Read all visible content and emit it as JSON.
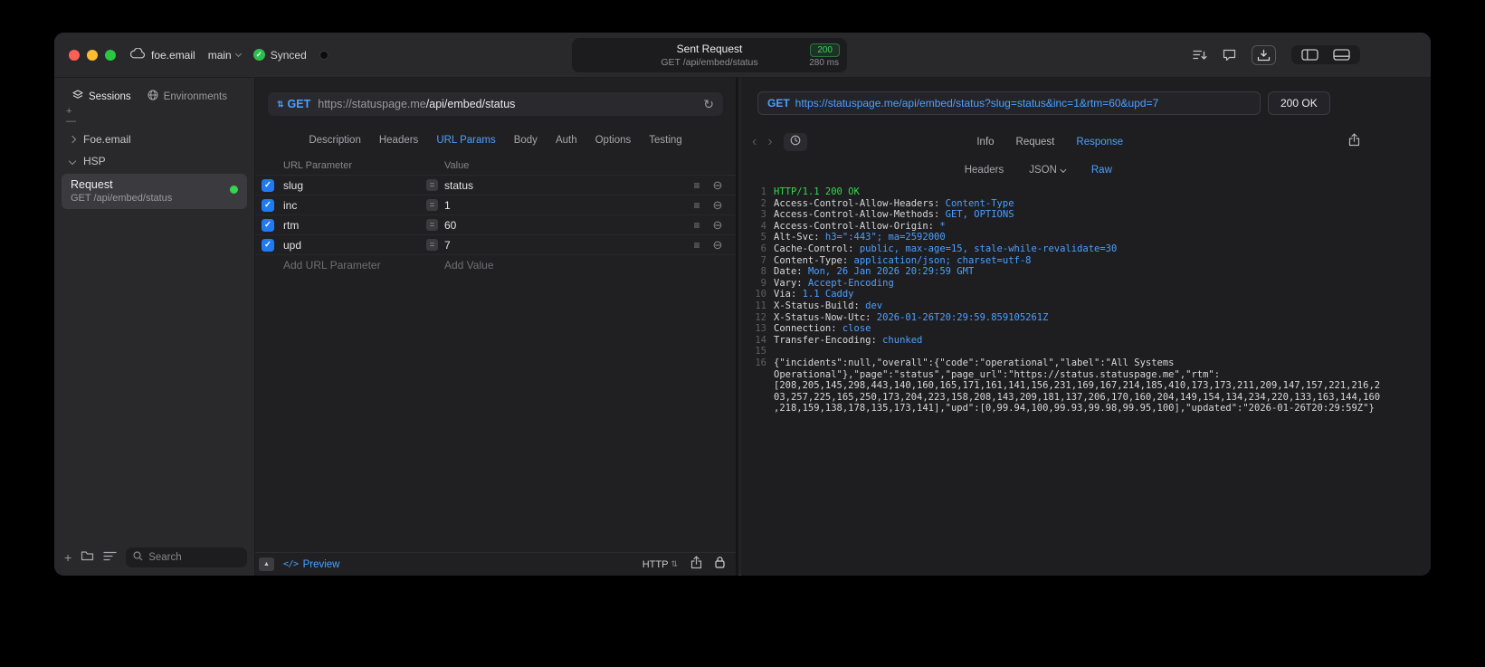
{
  "colors": {
    "accent_blue": "#4BA0FF",
    "status_green": "#32D74B",
    "badge_green": "#30D158"
  },
  "titlebar": {
    "project": "foe.email",
    "branch": "main",
    "sync_label": "Synced",
    "center": {
      "title": "Sent Request",
      "status_badge": "200",
      "request_line": "GET /api/embed/status",
      "duration": "280 ms"
    }
  },
  "sidebar": {
    "tabs": [
      {
        "label": "Sessions"
      },
      {
        "label": "Environments"
      }
    ],
    "tree": [
      {
        "label": "Foe.email",
        "expanded": false
      },
      {
        "label": "HSP",
        "expanded": true
      }
    ],
    "request_item": {
      "title": "Request",
      "subtitle": "GET /api/embed/status"
    },
    "search": {
      "placeholder": "Search"
    }
  },
  "request_panel": {
    "method": "GET",
    "url_host": "https://statuspage.me",
    "url_path": "/api/embed/status",
    "tabs": [
      "Description",
      "Headers",
      "URL Params",
      "Body",
      "Auth",
      "Options",
      "Testing"
    ],
    "active_tab": "URL Params",
    "params_table": {
      "columns": [
        "URL Parameter",
        "Value"
      ],
      "rows": [
        {
          "name": "slug",
          "value": "status",
          "checked": true
        },
        {
          "name": "inc",
          "value": "1",
          "checked": true
        },
        {
          "name": "rtm",
          "value": "60",
          "checked": true
        },
        {
          "name": "upd",
          "value": "7",
          "checked": true
        }
      ],
      "add_param_placeholder": "Add URL Parameter",
      "add_value_placeholder": "Add Value"
    },
    "footer": {
      "preview": "Preview",
      "protocol": "HTTP"
    }
  },
  "response_panel": {
    "method": "GET",
    "url": "https://statuspage.me/api/embed/status?slug=status&inc=1&rtm=60&upd=7",
    "status": "200 OK",
    "tabs": [
      "Info",
      "Request",
      "Response"
    ],
    "active_tab": "Response",
    "subtabs": [
      {
        "label": "Headers"
      },
      {
        "label": "JSON",
        "dropdown": true
      },
      {
        "label": "Raw"
      }
    ],
    "active_subtab": "Raw",
    "code": {
      "status_line": "HTTP/1.1 200 OK",
      "headers": [
        {
          "name": "Access-Control-Allow-Headers",
          "value": "Content-Type"
        },
        {
          "name": "Access-Control-Allow-Methods",
          "value": "GET, OPTIONS"
        },
        {
          "name": "Access-Control-Allow-Origin",
          "value": "*"
        },
        {
          "name": "Alt-Svc",
          "value": "h3=\":443\"; ma=2592000"
        },
        {
          "name": "Cache-Control",
          "value": "public, max-age=15, stale-while-revalidate=30"
        },
        {
          "name": "Content-Type",
          "value": "application/json; charset=utf-8"
        },
        {
          "name": "Date",
          "value": "Mon, 26 Jan 2026 20:29:59 GMT"
        },
        {
          "name": "Vary",
          "value": "Accept-Encoding"
        },
        {
          "name": "Via",
          "value": "1.1 Caddy"
        },
        {
          "name": "X-Status-Build",
          "value": "dev"
        },
        {
          "name": "X-Status-Now-Utc",
          "value": "2026-01-26T20:29:59.859105261Z"
        },
        {
          "name": "Connection",
          "value": "close"
        },
        {
          "name": "Transfer-Encoding",
          "value": "chunked"
        }
      ],
      "body": "{\"incidents\":null,\"overall\":{\"code\":\"operational\",\"label\":\"All Systems Operational\"},\"page\":\"status\",\"page_url\":\"https://status.statuspage.me\",\"rtm\":[208,205,145,298,443,140,160,165,171,161,141,156,231,169,167,214,185,410,173,173,211,209,147,157,221,216,203,257,225,165,250,173,204,223,158,208,143,209,181,137,206,170,160,204,149,154,134,234,220,133,163,144,160,218,159,138,178,135,173,141],\"upd\":[0,99.94,100,99.93,99.98,99.95,100],\"updated\":\"2026-01-26T20:29:59Z\"}"
    }
  }
}
